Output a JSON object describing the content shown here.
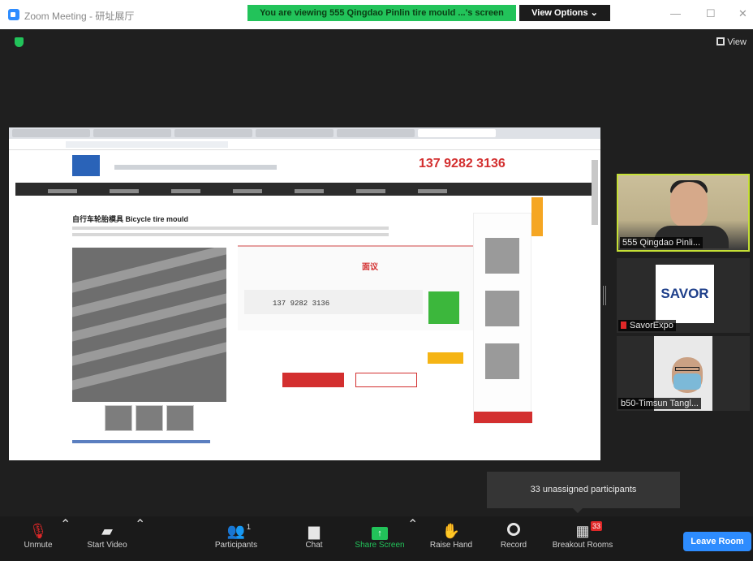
{
  "window": {
    "title": "Zoom Meeting - 研址展厅",
    "minimize": "—",
    "maximize": "☐",
    "close": "✕"
  },
  "share_banner": "You are viewing 555 Qingdao Pinlin tire mould ...'s screen",
  "view_options": "View Options ⌄",
  "view_toggle": "View",
  "shared_content": {
    "phone": "137 9282 3136",
    "product_title": "自行车轮胎模具 Bicycle tire mould",
    "highlight": "面议",
    "contact_number": "137 9282 3136"
  },
  "participants": [
    {
      "name": "555 Qingdao Pinli..."
    },
    {
      "name": "SavorExpo",
      "logo": "SAVOR"
    },
    {
      "name": "b50-Timsun Tangl..."
    }
  ],
  "unassigned": "33 unassigned participants",
  "toolbar": {
    "unmute": "Unmute",
    "start_video": "Start Video",
    "participants": "Participants",
    "participants_count": "1",
    "chat": "Chat",
    "share_screen": "Share Screen",
    "raise_hand": "Raise Hand",
    "record": "Record",
    "breakout_rooms": "Breakout Rooms",
    "breakout_badge": "33",
    "leave": "Leave Room"
  },
  "icons": {
    "unmute": "mic-off-icon",
    "start_video": "video-off-icon",
    "participants": "people-icon",
    "chat": "chat-bubble-icon",
    "share_screen": "share-arrow-icon",
    "raise_hand": "hand-icon",
    "record": "record-icon",
    "breakout_rooms": "grid-icon"
  },
  "colors": {
    "share_green": "#22c35a",
    "leave_blue": "#2d8cff",
    "active_border": "#c5e035",
    "badge_red": "#e02828"
  }
}
